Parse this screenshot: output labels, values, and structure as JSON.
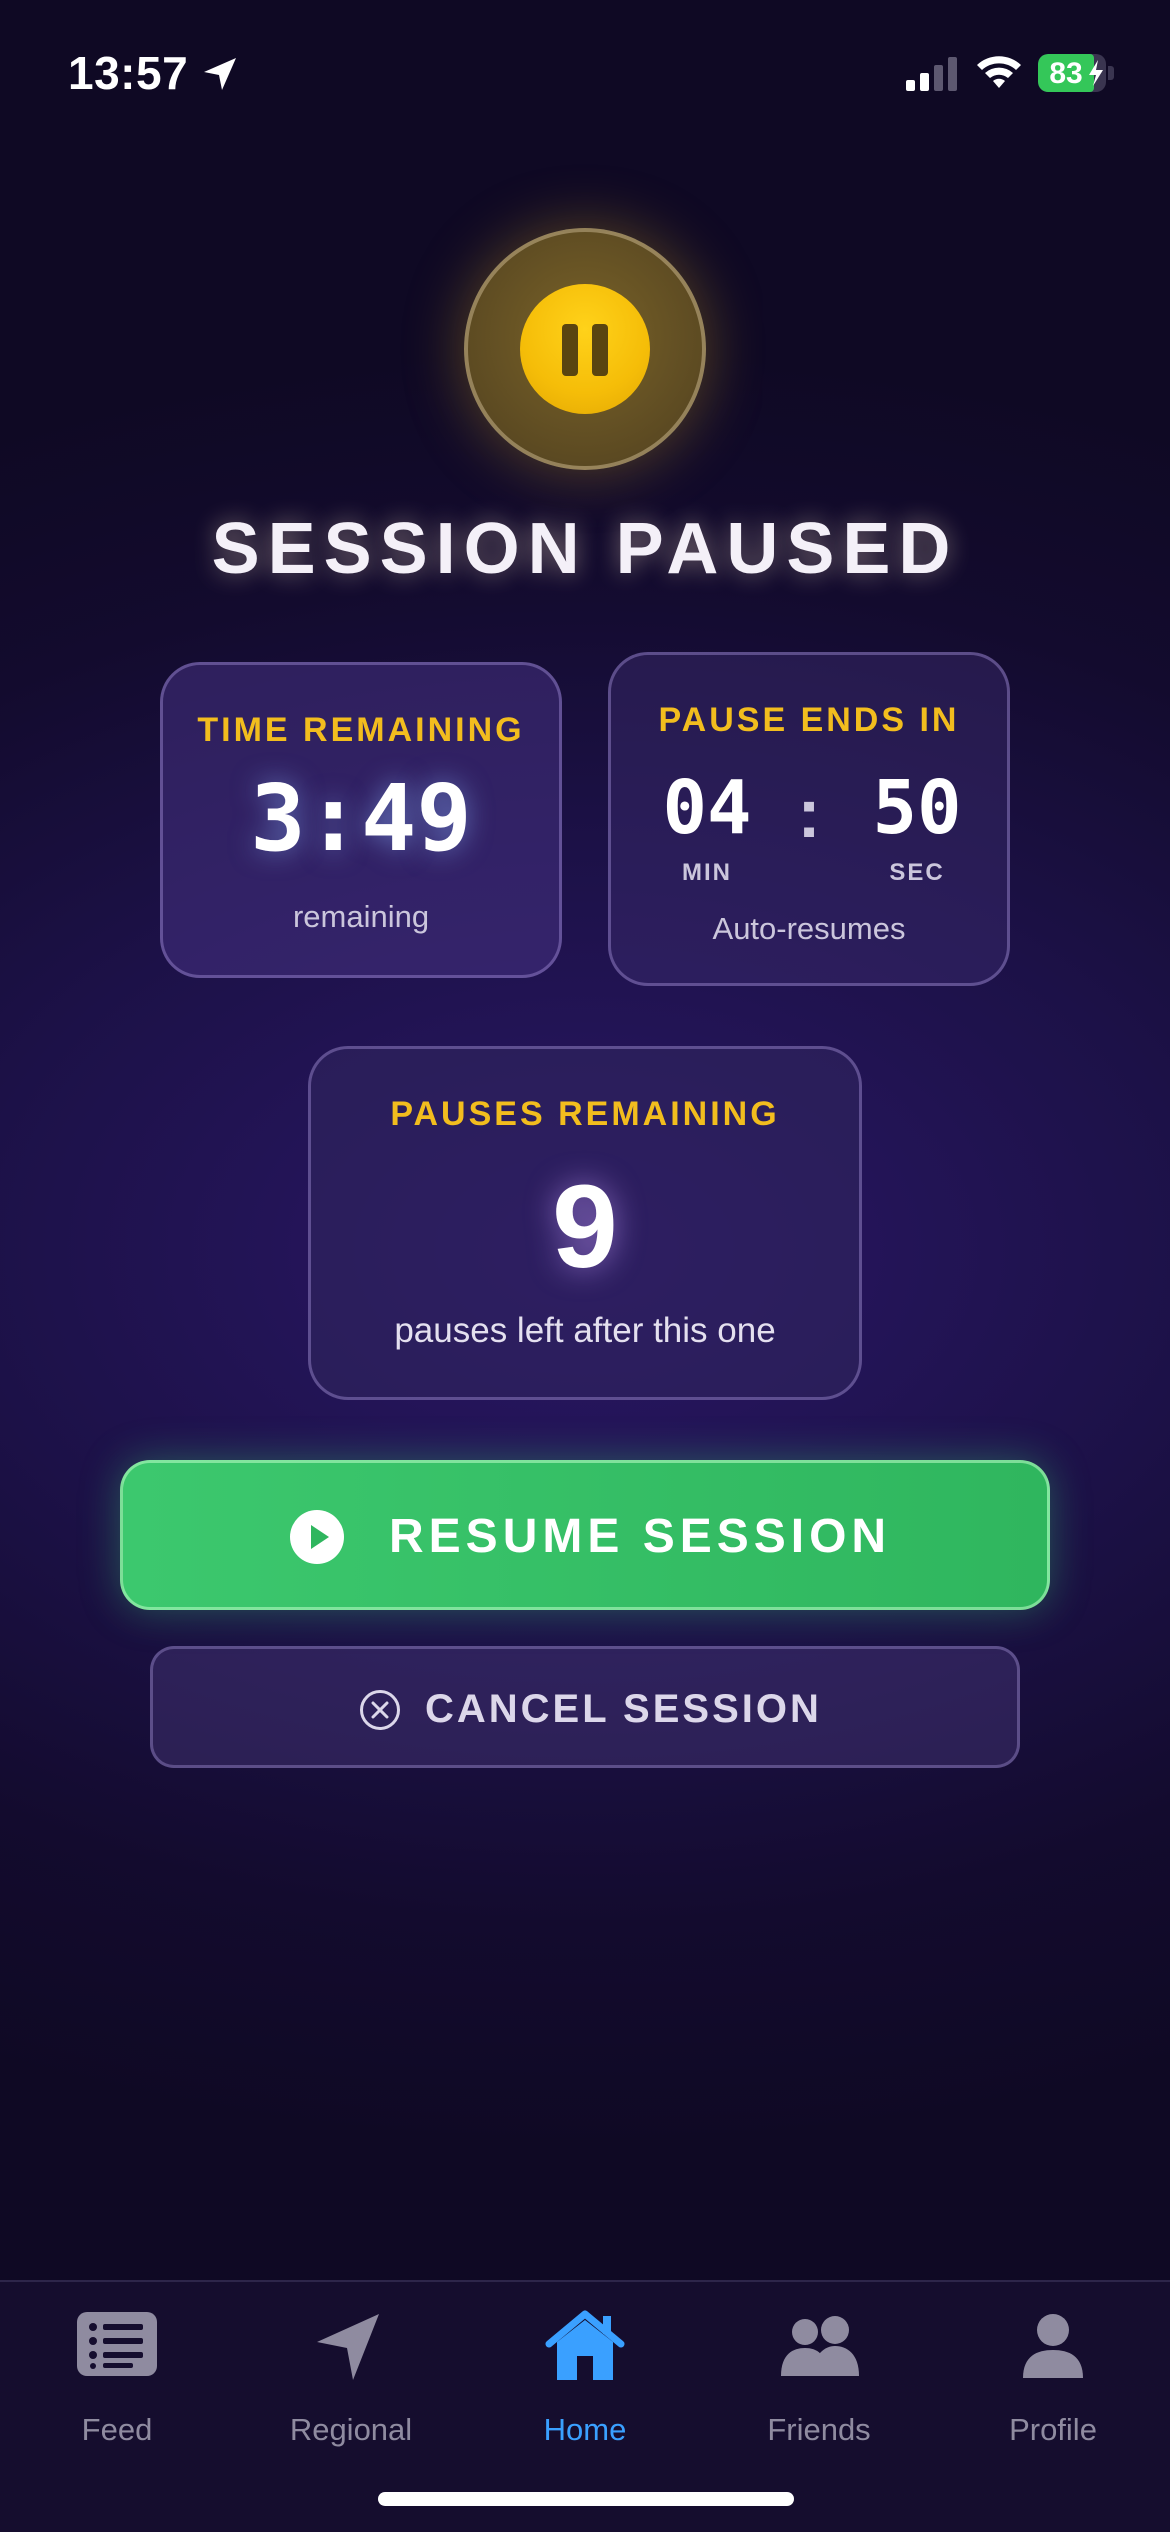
{
  "status_bar": {
    "time": "13:57",
    "battery_percent": "83",
    "battery_level": 0.83,
    "icons": [
      "location-arrow-icon",
      "cellular-signal-icon",
      "wifi-icon",
      "battery-charging-icon"
    ]
  },
  "header": {
    "status_icon": "pause-icon",
    "title": "SESSION PAUSED"
  },
  "time_card": {
    "heading": "TIME REMAINING",
    "value": "3:49",
    "caption": "remaining"
  },
  "pause_card": {
    "heading": "PAUSE ENDS IN",
    "minutes": "04",
    "minutes_unit": "MIN",
    "separator": ":",
    "seconds": "50",
    "seconds_unit": "SEC",
    "caption": "Auto-resumes"
  },
  "pauses_card": {
    "heading": "PAUSES REMAINING",
    "count": "9",
    "caption": "pauses left after this one"
  },
  "actions": {
    "resume_label": "RESUME SESSION",
    "resume_icon": "play-circle-icon",
    "cancel_label": "CANCEL SESSION",
    "cancel_icon": "close-circle-icon"
  },
  "tab_bar": {
    "tabs": [
      {
        "label": "Feed",
        "icon": "feed-list-icon"
      },
      {
        "label": "Regional",
        "icon": "navigation-arrow-icon"
      },
      {
        "label": "Home",
        "icon": "home-icon",
        "active": true
      },
      {
        "label": "Friends",
        "icon": "friends-icon"
      },
      {
        "label": "Profile",
        "icon": "profile-icon"
      }
    ]
  },
  "colors": {
    "accent_gold": "#f2bd1e",
    "resume_green": "#35c065",
    "active_tab_blue": "#3aa0ff",
    "background": "#1c1147"
  }
}
